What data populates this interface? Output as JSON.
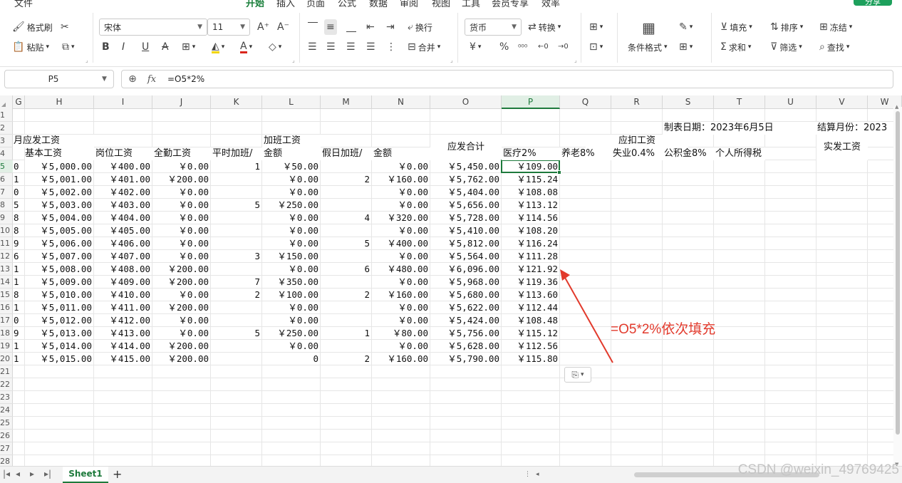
{
  "menu": {
    "items": [
      "开始",
      "插入",
      "页面",
      "公式",
      "数据",
      "审阅",
      "视图",
      "工具",
      "会员专享",
      "效率"
    ],
    "active": "开始",
    "share_label": "分享"
  },
  "ribbon": {
    "format_painter": "格式刷",
    "paste": "粘贴",
    "font_name": "宋体",
    "font_size": "11",
    "wrap_text": "换行",
    "merge": "合并",
    "number_format": "货币",
    "convert": "转换",
    "conditional_format": "条件格式",
    "fill": "填充",
    "sort": "排序",
    "freeze": "冻结",
    "sum": "求和",
    "filter": "筛选",
    "find": "查找"
  },
  "formula_bar": {
    "cell_ref": "P5",
    "formula": "=O5*2%"
  },
  "columns": [
    "G",
    "H",
    "I",
    "J",
    "K",
    "L",
    "M",
    "N",
    "O",
    "P",
    "Q",
    "R",
    "S",
    "T",
    "U",
    "V",
    "W"
  ],
  "rows": [
    "1",
    "2",
    "3",
    "4",
    "5",
    "6",
    "7",
    "8",
    "9",
    "10",
    "11",
    "12",
    "13",
    "14",
    "15",
    "16",
    "17",
    "18",
    "19",
    "20",
    "21",
    "22",
    "23",
    "24",
    "25",
    "26",
    "27",
    "28"
  ],
  "selected_column": "P",
  "selected_row": "5",
  "headers": {
    "report_date": "制表日期：2023年6月5日",
    "settle_month": "结算月份：2023",
    "gross_group_partial": "月应发工资",
    "overtime_group": "加班工资",
    "gross_total": "应发合计",
    "deduct_group": "应扣工资",
    "net_pay": "实发工资",
    "base_salary": "基本工资",
    "post_salary": "岗位工资",
    "attendance": "全勤工资",
    "ot_normal": "平时加班/",
    "ot_normal_amt": "金额",
    "ot_holiday": "假日加班/",
    "ot_holiday_amt": "金额",
    "medical": "医疗2%",
    "pension": "养老8%",
    "unemployment": "失业0.4%",
    "housing_fund": "公积金8%",
    "income_tax": "个人所得税"
  },
  "table_rows": [
    {
      "g": "0",
      "h": "￥5,000.00",
      "i": "￥400.00",
      "j": "￥0.00",
      "k": "1",
      "l": "￥50.00",
      "m": "",
      "n": "￥0.00",
      "o": "￥5,450.00",
      "p": "￥109.00"
    },
    {
      "g": "1",
      "h": "￥5,001.00",
      "i": "￥401.00",
      "j": "￥200.00",
      "k": "",
      "l": "￥0.00",
      "m": "2",
      "n": "￥160.00",
      "o": "￥5,762.00",
      "p": "￥115.24"
    },
    {
      "g": "0",
      "h": "￥5,002.00",
      "i": "￥402.00",
      "j": "￥0.00",
      "k": "",
      "l": "￥0.00",
      "m": "",
      "n": "￥0.00",
      "o": "￥5,404.00",
      "p": "￥108.08"
    },
    {
      "g": "5",
      "h": "￥5,003.00",
      "i": "￥403.00",
      "j": "￥0.00",
      "k": "5",
      "l": "￥250.00",
      "m": "",
      "n": "￥0.00",
      "o": "￥5,656.00",
      "p": "￥113.12"
    },
    {
      "g": "8",
      "h": "￥5,004.00",
      "i": "￥404.00",
      "j": "￥0.00",
      "k": "",
      "l": "￥0.00",
      "m": "4",
      "n": "￥320.00",
      "o": "￥5,728.00",
      "p": "￥114.56"
    },
    {
      "g": "8",
      "h": "￥5,005.00",
      "i": "￥405.00",
      "j": "￥0.00",
      "k": "",
      "l": "￥0.00",
      "m": "",
      "n": "￥0.00",
      "o": "￥5,410.00",
      "p": "￥108.20"
    },
    {
      "g": "9",
      "h": "￥5,006.00",
      "i": "￥406.00",
      "j": "￥0.00",
      "k": "",
      "l": "￥0.00",
      "m": "5",
      "n": "￥400.00",
      "o": "￥5,812.00",
      "p": "￥116.24"
    },
    {
      "g": "6",
      "h": "￥5,007.00",
      "i": "￥407.00",
      "j": "￥0.00",
      "k": "3",
      "l": "￥150.00",
      "m": "",
      "n": "￥0.00",
      "o": "￥5,564.00",
      "p": "￥111.28"
    },
    {
      "g": "1",
      "h": "￥5,008.00",
      "i": "￥408.00",
      "j": "￥200.00",
      "k": "",
      "l": "￥0.00",
      "m": "6",
      "n": "￥480.00",
      "o": "￥6,096.00",
      "p": "￥121.92"
    },
    {
      "g": "1",
      "h": "￥5,009.00",
      "i": "￥409.00",
      "j": "￥200.00",
      "k": "7",
      "l": "￥350.00",
      "m": "",
      "n": "￥0.00",
      "o": "￥5,968.00",
      "p": "￥119.36"
    },
    {
      "g": "8",
      "h": "￥5,010.00",
      "i": "￥410.00",
      "j": "￥0.00",
      "k": "2",
      "l": "￥100.00",
      "m": "2",
      "n": "￥160.00",
      "o": "￥5,680.00",
      "p": "￥113.60"
    },
    {
      "g": "1",
      "h": "￥5,011.00",
      "i": "￥411.00",
      "j": "￥200.00",
      "k": "",
      "l": "￥0.00",
      "m": "",
      "n": "￥0.00",
      "o": "￥5,622.00",
      "p": "￥112.44"
    },
    {
      "g": "0",
      "h": "￥5,012.00",
      "i": "￥412.00",
      "j": "￥0.00",
      "k": "",
      "l": "￥0.00",
      "m": "",
      "n": "￥0.00",
      "o": "￥5,424.00",
      "p": "￥108.48"
    },
    {
      "g": "9",
      "h": "￥5,013.00",
      "i": "￥413.00",
      "j": "￥0.00",
      "k": "5",
      "l": "￥250.00",
      "m": "1",
      "n": "￥80.00",
      "o": "￥5,756.00",
      "p": "￥115.12"
    },
    {
      "g": "1",
      "h": "￥5,014.00",
      "i": "￥414.00",
      "j": "￥200.00",
      "k": "",
      "l": "￥0.00",
      "m": "",
      "n": "￥0.00",
      "o": "￥5,628.00",
      "p": "￥112.56"
    },
    {
      "g": "1",
      "h": "￥5,015.00",
      "i": "￥415.00",
      "j": "￥200.00",
      "k": "",
      "l": "0",
      "m": "2",
      "n": "￥160.00",
      "o": "￥5,790.00",
      "p": "￥115.80"
    }
  ],
  "annotation": {
    "text": "=O5*2%依次填充",
    "color": "#e23a2c"
  },
  "sheet": {
    "tab_label": "Sheet1",
    "add_label": "+"
  },
  "watermark": "CSDN @weixin_49769425",
  "colors": {
    "accent": "#1e7a3c",
    "annotation": "#e23a2c",
    "share_button": "#1da05c"
  }
}
